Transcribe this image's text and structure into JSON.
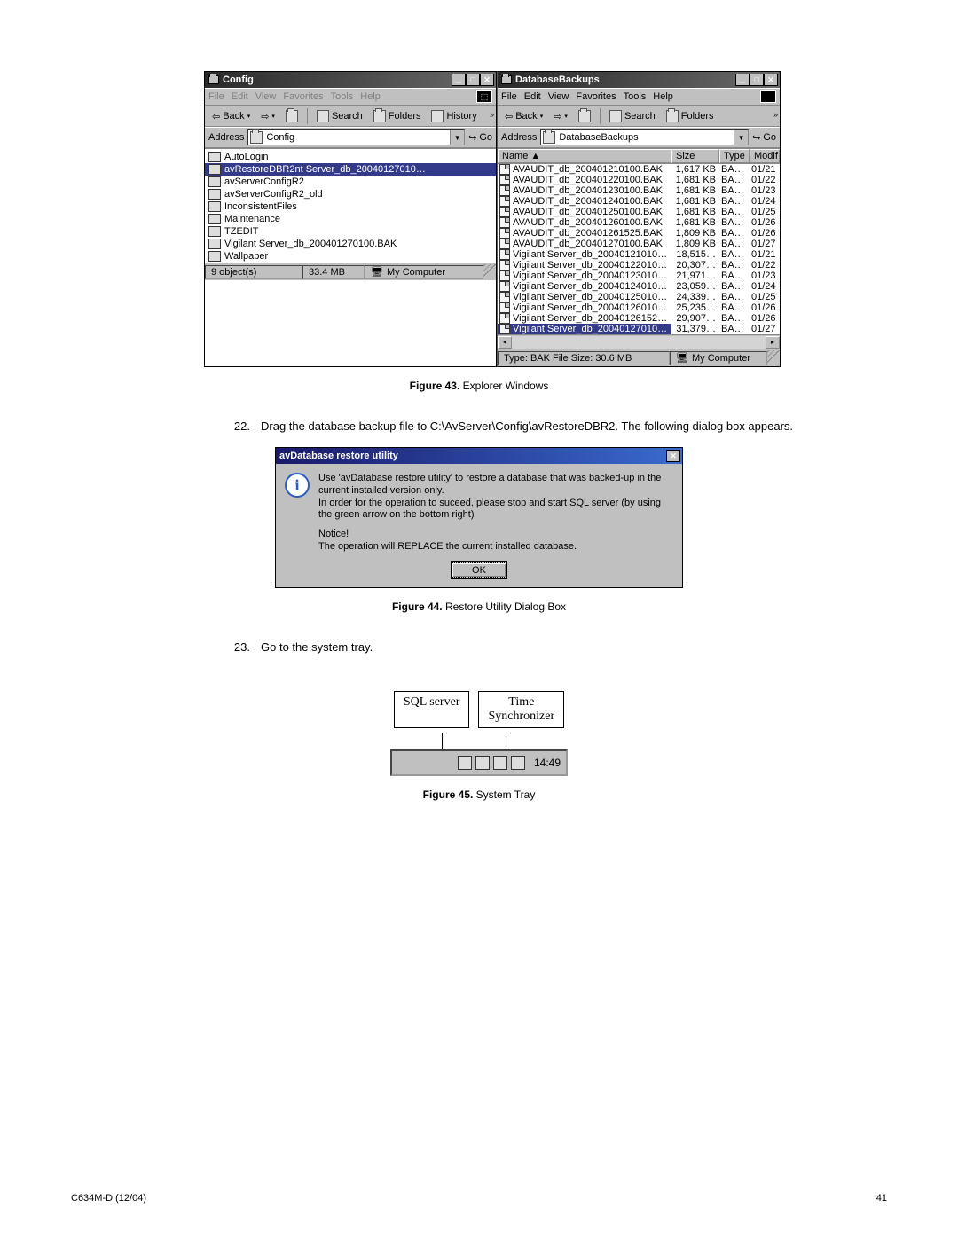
{
  "document": {
    "footer_left": "C634M-D (12/04)",
    "footer_right": "41"
  },
  "figure43": {
    "caption_label": "Figure 43.",
    "caption_text": "Explorer Windows",
    "leftWindow": {
      "title": "Config",
      "menus": [
        "File",
        "Edit",
        "View",
        "Favorites",
        "Tools",
        "Help"
      ],
      "toolbar": {
        "back": "Back",
        "search": "Search",
        "folders": "Folders",
        "history": "History"
      },
      "address_label": "Address",
      "address_value": "Config",
      "go": "Go",
      "items": [
        {
          "name": "AutoLogin"
        },
        {
          "name": "avRestoreDBR2",
          "selected": true,
          "suffix": "nt Server_db_20040127010…"
        },
        {
          "name": "avServerConfigR2"
        },
        {
          "name": "avServerConfigR2_old"
        },
        {
          "name": "InconsistentFiles"
        },
        {
          "name": "Maintenance"
        },
        {
          "name": "TZEDIT"
        },
        {
          "name": "Vigilant Server_db_200401270100.BAK"
        },
        {
          "name": "Wallpaper"
        }
      ],
      "status_left": "9 object(s)",
      "status_mid": "33.4 MB",
      "status_right": "My Computer"
    },
    "rightWindow": {
      "title": "DatabaseBackups",
      "menus": [
        "File",
        "Edit",
        "View",
        "Favorites",
        "Tools",
        "Help"
      ],
      "toolbar": {
        "back": "Back",
        "search": "Search",
        "folders": "Folders"
      },
      "address_label": "Address",
      "address_value": "DatabaseBackups",
      "go": "Go",
      "columns": {
        "name": "Name",
        "size": "Size",
        "type": "Type",
        "modified": "Modif"
      },
      "rows": [
        {
          "name": "AVAUDIT_db_200401210100.BAK",
          "size": "1,617 KB",
          "type": "BA…",
          "mod": "01/21"
        },
        {
          "name": "AVAUDIT_db_200401220100.BAK",
          "size": "1,681 KB",
          "type": "BA…",
          "mod": "01/22"
        },
        {
          "name": "AVAUDIT_db_200401230100.BAK",
          "size": "1,681 KB",
          "type": "BA…",
          "mod": "01/23"
        },
        {
          "name": "AVAUDIT_db_200401240100.BAK",
          "size": "1,681 KB",
          "type": "BA…",
          "mod": "01/24"
        },
        {
          "name": "AVAUDIT_db_200401250100.BAK",
          "size": "1,681 KB",
          "type": "BA…",
          "mod": "01/25"
        },
        {
          "name": "AVAUDIT_db_200401260100.BAK",
          "size": "1,681 KB",
          "type": "BA…",
          "mod": "01/26"
        },
        {
          "name": "AVAUDIT_db_200401261525.BAK",
          "size": "1,809 KB",
          "type": "BA…",
          "mod": "01/26"
        },
        {
          "name": "AVAUDIT_db_200401270100.BAK",
          "size": "1,809 KB",
          "type": "BA…",
          "mod": "01/27"
        },
        {
          "name": "Vigilant Server_db_20040121010…",
          "size": "18,515…",
          "type": "BA…",
          "mod": "01/21"
        },
        {
          "name": "Vigilant Server_db_20040122010…",
          "size": "20,307…",
          "type": "BA…",
          "mod": "01/22"
        },
        {
          "name": "Vigilant Server_db_20040123010…",
          "size": "21,971…",
          "type": "BA…",
          "mod": "01/23"
        },
        {
          "name": "Vigilant Server_db_20040124010…",
          "size": "23,059…",
          "type": "BA…",
          "mod": "01/24"
        },
        {
          "name": "Vigilant Server_db_20040125010…",
          "size": "24,339…",
          "type": "BA…",
          "mod": "01/25"
        },
        {
          "name": "Vigilant Server_db_20040126010…",
          "size": "25,235…",
          "type": "BA…",
          "mod": "01/26"
        },
        {
          "name": "Vigilant Server_db_20040126152…",
          "size": "29,907…",
          "type": "BA…",
          "mod": "01/26"
        },
        {
          "name": "Vigilant Server_db_20040127010…",
          "size": "31,379…",
          "type": "BA…",
          "mod": "01/27",
          "selected": true
        }
      ],
      "status_left": "Type: BAK File Size: 30.6 MB",
      "status_right": "My Computer"
    }
  },
  "step22": {
    "num": "22.",
    "text": "Drag the database backup file to C:\\AvServer\\Config\\avRestoreDBR2. The following dialog box appears."
  },
  "figure44": {
    "caption_label": "Figure 44.",
    "caption_text": "Restore Utility Dialog Box",
    "dialog": {
      "title": "avDatabase restore utility",
      "line1": "Use 'avDatabase restore utility' to restore a database that was backed-up in the current installed version only.",
      "line2": "In order for the operation to suceed, please stop and start SQL server (by using the green arrow on the bottom right)",
      "notice_head": "Notice!",
      "notice_body": "The operation will REPLACE the current installed database.",
      "ok": "OK"
    }
  },
  "step23": {
    "num": "23.",
    "text": "Go to the system tray."
  },
  "figure45": {
    "caption_label": "Figure 45.",
    "caption_text": "System Tray",
    "labels": {
      "sql": "SQL server",
      "time": "Time\nSynchronizer"
    },
    "clock": "14:49"
  }
}
